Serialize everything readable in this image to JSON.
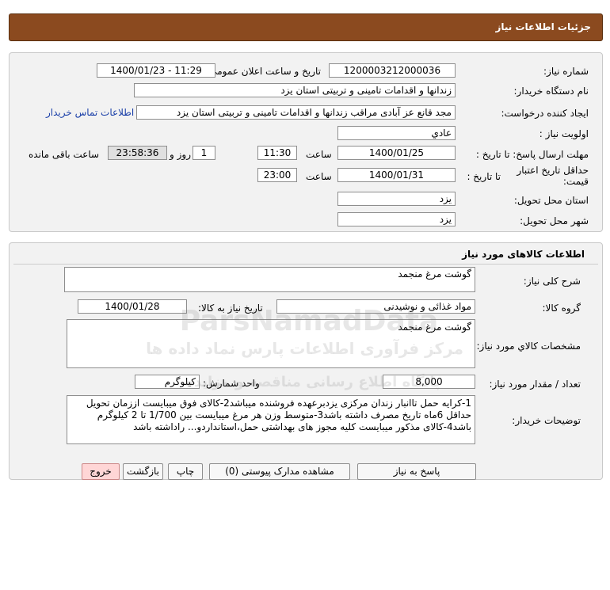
{
  "header": {
    "title": "جزئیات اطلاعات نیاز"
  },
  "info": {
    "need_number_label": "شماره نیاز:",
    "need_number": "1200003212000036",
    "announce_label": "تاریخ و ساعت اعلان عمومی:",
    "announce_value": "1400/01/23 - 11:29",
    "buyer_org_label": "نام دستگاه خریدار:",
    "buyer_org": "زندانها و اقدامات تامینی و تربیتی استان یزد",
    "requester_label": "ایجاد کننده درخواست:",
    "requester": "مجد قانع عز آبادی  مراقب زندانها و اقدامات تامینی و تربیتی استان یزد",
    "contact_link": "اطلاعات تماس خریدار",
    "priority_label": "اولویت نیاز :",
    "priority": "عادي",
    "deadline_label": "مهلت ارسال پاسخ:  تا تاریخ :",
    "deadline_date": "1400/01/25",
    "time_label": "ساعت",
    "deadline_time": "11:30",
    "days_value": "1",
    "days_label": "روز و",
    "remaining_time": "23:58:36",
    "remaining_label": "ساعت باقی مانده",
    "validity_label": "حداقل تاریخ اعتبار قیمت:",
    "validity_to_label": "تا تاریخ :",
    "validity_date": "1400/01/31",
    "validity_time": "23:00",
    "province_label": "استان محل تحویل:",
    "province": "یزد",
    "city_label": "شهر محل تحویل:",
    "city": "یزد"
  },
  "goods": {
    "section_title": "اطلاعات کالاهای مورد نیاز",
    "general_desc_label": "شرح کلی نیاز:",
    "general_desc": "گوشت مرغ منجمد",
    "group_label": "گروه کالا:",
    "group": "مواد غذائی و نوشیدنی",
    "need_date_label": "تاریخ نیاز به کالا:",
    "need_date": "1400/01/28",
    "specs_label": "مشخصات كالاي مورد نياز:",
    "specs": "گوشت مرغ منجمد",
    "qty_label": "تعداد / مقدار مورد نیاز:",
    "qty": "8,000",
    "unit_label": "واحد شمارش:",
    "unit": "کیلوگرم",
    "buyer_notes_label": "توضیحات خریدار:",
    "buyer_notes": "1-کرایه حمل تاانبار زندان مرکزی یزدبرعهده فروشنده میباشد2-کالای فوق میبایست اززمان تحویل حداقل 6ماه تاریخ مصرف داشته باشد3-متوسط وزن هر مرغ میبایست بین 1/700 تا 2 کیلوگرم باشد4-کالای مذکور میبایست کلیه مجوز های بهداشتی حمل،استانداردو... راداشته باشد"
  },
  "buttons": {
    "reply": "پاسخ به نیاز",
    "view_docs": "مشاهده مدارک پیوستی (0)",
    "print": "چاپ",
    "back": "بازگشت",
    "exit": "خروج"
  },
  "watermark": {
    "line1": "ParsNamadData",
    "line2": "مرکز فرآوری اطلاعات پارس نماد داده ها",
    "line3": "پایگاه اطلاع رسانی مناقصه و مزایده"
  },
  "colors": {
    "header_bg": "#8b4a1f",
    "panel_bg": "#f2f2f2",
    "link": "#1a3fa8",
    "exit_btn": "#ffd6d6"
  }
}
